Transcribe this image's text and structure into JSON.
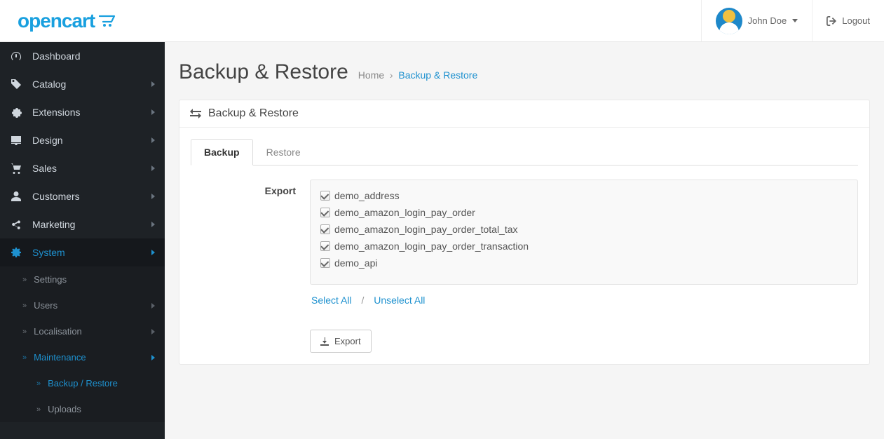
{
  "header": {
    "logo_text": "opencart",
    "username": "John Doe",
    "logout_label": "Logout"
  },
  "sidebar": {
    "dashboard": "Dashboard",
    "catalog": "Catalog",
    "extensions": "Extensions",
    "design": "Design",
    "sales": "Sales",
    "customers": "Customers",
    "marketing": "Marketing",
    "system": "System",
    "system_children": {
      "settings": "Settings",
      "users": "Users",
      "localisation": "Localisation",
      "maintenance": "Maintenance",
      "maintenance_children": {
        "backup_restore": "Backup / Restore",
        "uploads": "Uploads"
      }
    }
  },
  "page": {
    "title": "Backup & Restore",
    "breadcrumb_home": "Home",
    "breadcrumb_current": "Backup & Restore",
    "panel_title": "Backup & Restore"
  },
  "tabs": {
    "backup": "Backup",
    "restore": "Restore"
  },
  "form": {
    "export_label": "Export",
    "select_all": "Select All",
    "unselect_all": "Unselect All",
    "export_button": "Export"
  },
  "tables": [
    "demo_address",
    "demo_amazon_login_pay_order",
    "demo_amazon_login_pay_order_total_tax",
    "demo_amazon_login_pay_order_transaction",
    "demo_api"
  ]
}
